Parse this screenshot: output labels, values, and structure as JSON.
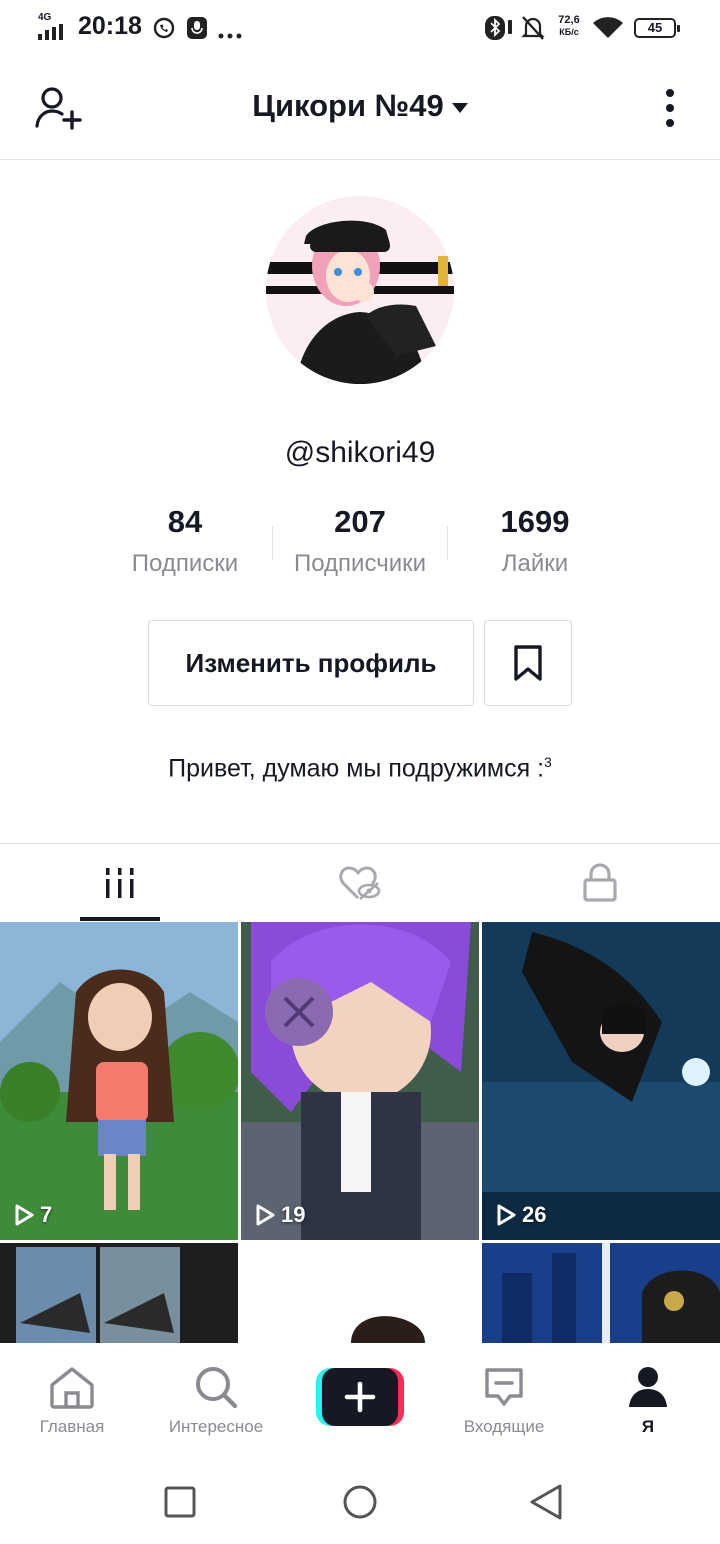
{
  "status_bar": {
    "network": "4G",
    "time": "20:18",
    "speed_value": "72,6",
    "speed_unit": "КБ/с",
    "battery": "45"
  },
  "header": {
    "title": "Цикори №49"
  },
  "profile": {
    "username": "@shikori49",
    "stats": [
      {
        "value": "84",
        "label": "Подписки"
      },
      {
        "value": "207",
        "label": "Подписчики"
      },
      {
        "value": "1699",
        "label": "Лайки"
      }
    ],
    "edit_button": "Изменить профиль",
    "bio": "Привет, думаю мы подружимся :",
    "bio_sup": "3"
  },
  "videos": [
    {
      "views": "7"
    },
    {
      "views": "19"
    },
    {
      "views": "26"
    }
  ],
  "bottom_nav": [
    {
      "label": "Главная",
      "icon": "home-icon"
    },
    {
      "label": "Интересное",
      "icon": "search-icon"
    },
    {
      "label": "",
      "icon": "plus-icon"
    },
    {
      "label": "Входящие",
      "icon": "inbox-icon"
    },
    {
      "label": "Я",
      "icon": "profile-icon"
    }
  ],
  "colors": {
    "accent_cyan": "#25f4ee",
    "accent_red": "#fe2c55",
    "text": "#161823",
    "muted": "#8a8b91"
  }
}
